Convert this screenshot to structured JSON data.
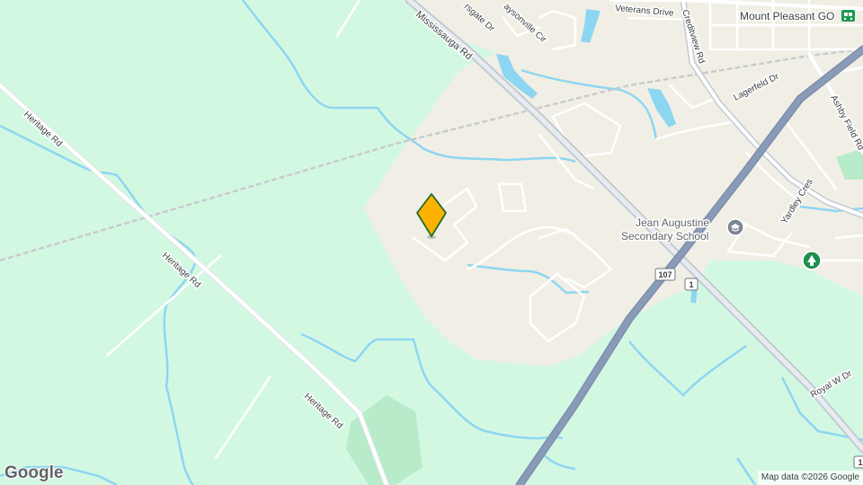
{
  "map": {
    "colors": {
      "land": "#d3f8e2",
      "urban": "#f1efe5",
      "water": "#8dd6f2",
      "highway": "#8a9bb8",
      "road": "#ffffff",
      "marker": "#fbb200"
    },
    "labels": {
      "mississauga_rd": "Mississauga Rd",
      "heritage_rd_1": "Heritage Rd",
      "heritage_rd_2": "Heritage Rd",
      "heritage_rd_3": "Heritage Rd",
      "veterans_drive": "Veterans Drive",
      "creditview_rd": "Creditview Rd",
      "lagerfeld_dr": "Lagerfeld Dr",
      "ashby_field_rd": "Ashby Field Rd",
      "yardley_cres": "Yardley Cres",
      "royal_w_dr": "Royal W Dr",
      "fairsgate_dr": "rsgate Dr",
      "daysonville_cir": "aysonville Cir",
      "mount_pleasant_go": "Mount Pleasant GO",
      "school_line1": "Jean Augustine",
      "school_line2": "Secondary School"
    },
    "shields": {
      "hwy_107": "107",
      "hwy_1": "1",
      "hwy_1_bottom": "1"
    },
    "icons": {
      "marker": "location-pin-icon",
      "school": "school-icon",
      "park": "park-tree-icon",
      "transit": "transit-station-icon"
    },
    "attribution": "Map data ©2026 Google",
    "logo": "Google"
  }
}
